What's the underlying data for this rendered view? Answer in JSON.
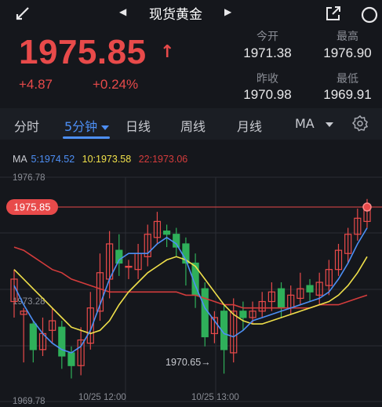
{
  "header": {
    "title": "现货黄金"
  },
  "quote": {
    "price": "1975.85",
    "change": "+4.87",
    "change_pct": "+0.24%",
    "stats": [
      {
        "label": "今开",
        "value": "1971.38"
      },
      {
        "label": "最高",
        "value": "1976.90"
      },
      {
        "label": "昨收",
        "value": "1970.98"
      },
      {
        "label": "最低",
        "value": "1969.91"
      }
    ]
  },
  "tabs": [
    "分时",
    "5分钟",
    "日线",
    "周线",
    "月线",
    "MA"
  ],
  "active_tab": "5分钟",
  "legend": {
    "ma": "MA",
    "ma5": "5:1974.52",
    "ma10": "10:1973.58",
    "ma22": "22:1973.06"
  },
  "colors": {
    "up": "#e84a4a",
    "down": "#2fb05a",
    "ma5": "#4d8ff5",
    "ma10": "#f0e04a",
    "ma22": "#d43c3c",
    "accent": "#4d8ff5"
  },
  "chart_data": {
    "type": "candlestick",
    "y_axis_labels": [
      "1976.78",
      "1973.28",
      "1969.78"
    ],
    "ylim": [
      1969.78,
      1976.78
    ],
    "last_price_label": "1975.85",
    "low_annotation": "1970.65→",
    "x_labels": [
      "10/25 12:00",
      "10/25 13:00"
    ],
    "candles": [
      [
        1972.9,
        1973.6,
        1972.4,
        1973.9
      ],
      [
        1972.5,
        1972.6,
        1971.0,
        1972.7
      ],
      [
        1972.2,
        1971.4,
        1971.0,
        1972.3
      ],
      [
        1971.4,
        1971.9,
        1971.2,
        1972.4
      ],
      [
        1972.0,
        1972.3,
        1971.6,
        1972.7
      ],
      [
        1972.1,
        1971.2,
        1970.8,
        1972.3
      ],
      [
        1971.3,
        1970.9,
        1970.5,
        1971.5
      ],
      [
        1970.9,
        1971.7,
        1970.6,
        1972.1
      ],
      [
        1971.6,
        1972.7,
        1971.4,
        1973.2
      ],
      [
        1972.6,
        1973.8,
        1972.3,
        1974.4
      ],
      [
        1973.6,
        1974.7,
        1973.0,
        1975.1
      ],
      [
        1974.5,
        1974.1,
        1973.7,
        1975.0
      ],
      [
        1974.0,
        1974.0,
        1973.6,
        1974.2
      ],
      [
        1973.9,
        1974.4,
        1973.6,
        1974.7
      ],
      [
        1974.3,
        1975.0,
        1974.0,
        1975.3
      ],
      [
        1974.9,
        1975.4,
        1974.7,
        1975.7
      ],
      [
        1975.1,
        1975.0,
        1974.6,
        1975.3
      ],
      [
        1975.0,
        1974.6,
        1974.3,
        1975.2
      ],
      [
        1974.7,
        1974.1,
        1973.4,
        1974.9
      ],
      [
        1974.1,
        1973.1,
        1972.7,
        1974.4
      ],
      [
        1973.3,
        1971.8,
        1971.5,
        1973.5
      ],
      [
        1971.9,
        1972.4,
        1971.6,
        1972.6
      ],
      [
        1972.6,
        1971.4,
        1970.65,
        1972.8
      ],
      [
        1971.3,
        1972.6,
        1971.0,
        1973.0
      ],
      [
        1972.6,
        1972.4,
        1972.0,
        1972.9
      ],
      [
        1972.4,
        1972.6,
        1972.2,
        1972.9
      ],
      [
        1972.6,
        1972.9,
        1972.4,
        1973.2
      ],
      [
        1972.9,
        1973.2,
        1972.6,
        1973.5
      ],
      [
        1973.3,
        1972.7,
        1972.4,
        1973.5
      ],
      [
        1972.7,
        1973.1,
        1972.5,
        1973.4
      ],
      [
        1973.0,
        1973.3,
        1972.8,
        1973.8
      ],
      [
        1973.4,
        1973.2,
        1972.9,
        1973.6
      ],
      [
        1973.1,
        1973.5,
        1972.8,
        1973.8
      ],
      [
        1973.4,
        1973.9,
        1973.1,
        1974.2
      ],
      [
        1973.9,
        1974.5,
        1973.7,
        1974.7
      ],
      [
        1974.4,
        1975.0,
        1974.1,
        1975.2
      ],
      [
        1975.0,
        1975.5,
        1974.8,
        1975.8
      ],
      [
        1975.4,
        1975.85,
        1975.2,
        1976.1
      ]
    ],
    "ma5": [
      1973.4,
      1972.8,
      1972.3,
      1971.9,
      1971.6,
      1971.4,
      1971.3,
      1971.5,
      1972.0,
      1972.8,
      1973.6,
      1974.2,
      1974.4,
      1974.4,
      1974.4,
      1974.7,
      1974.9,
      1974.7,
      1974.2,
      1973.4,
      1972.7,
      1972.3,
      1971.9,
      1971.8,
      1972.0,
      1972.3,
      1972.4,
      1972.5,
      1972.6,
      1972.7,
      1972.8,
      1972.9,
      1973.0,
      1973.2,
      1973.6,
      1974.1,
      1974.7,
      1975.2
    ],
    "ma10": [
      1973.9,
      1973.6,
      1973.3,
      1973.0,
      1972.7,
      1972.4,
      1972.1,
      1972.0,
      1971.9,
      1972.0,
      1972.3,
      1972.8,
      1973.2,
      1973.5,
      1973.8,
      1974.0,
      1974.2,
      1974.3,
      1974.2,
      1974.0,
      1973.6,
      1973.2,
      1972.8,
      1972.5,
      1972.3,
      1972.2,
      1972.2,
      1972.3,
      1972.4,
      1972.5,
      1972.6,
      1972.7,
      1972.8,
      1972.9,
      1973.1,
      1973.4,
      1973.8,
      1974.3
    ],
    "ma22": [
      1974.6,
      1974.5,
      1974.3,
      1974.1,
      1973.9,
      1973.8,
      1973.6,
      1973.5,
      1973.4,
      1973.3,
      1973.2,
      1973.2,
      1973.2,
      1973.2,
      1973.2,
      1973.2,
      1973.2,
      1973.2,
      1973.1,
      1973.1,
      1973.0,
      1972.9,
      1972.8,
      1972.8,
      1972.7,
      1972.7,
      1972.7,
      1972.7,
      1972.7,
      1972.7,
      1972.7,
      1972.7,
      1972.8,
      1972.8,
      1972.8,
      1972.9,
      1973.0,
      1973.1
    ]
  }
}
